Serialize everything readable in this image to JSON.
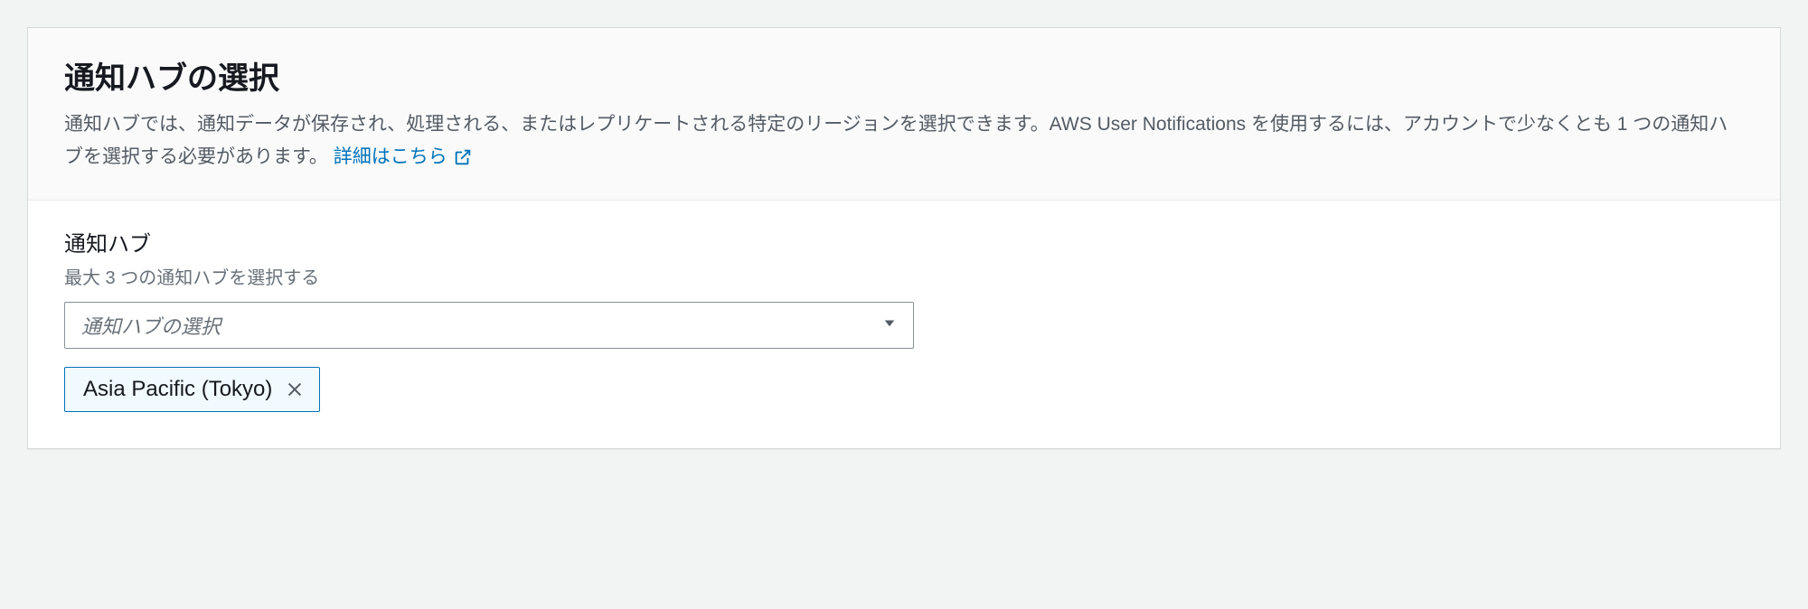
{
  "header": {
    "title": "通知ハブの選択",
    "description_part1": "通知ハブでは、通知データが保存され、処理される、またはレプリケートされる特定のリージョンを選択できます。AWS User Notifications を使用するには、アカウントで少なくとも 1 つの通知ハブを選択する必要があります。 ",
    "learn_more": "詳細はこちら"
  },
  "form": {
    "label": "通知ハブ",
    "hint": "最大 3 つの通知ハブを選択する",
    "placeholder": "通知ハブの選択",
    "selected_tokens": [
      {
        "label": "Asia Pacific (Tokyo)"
      }
    ]
  }
}
